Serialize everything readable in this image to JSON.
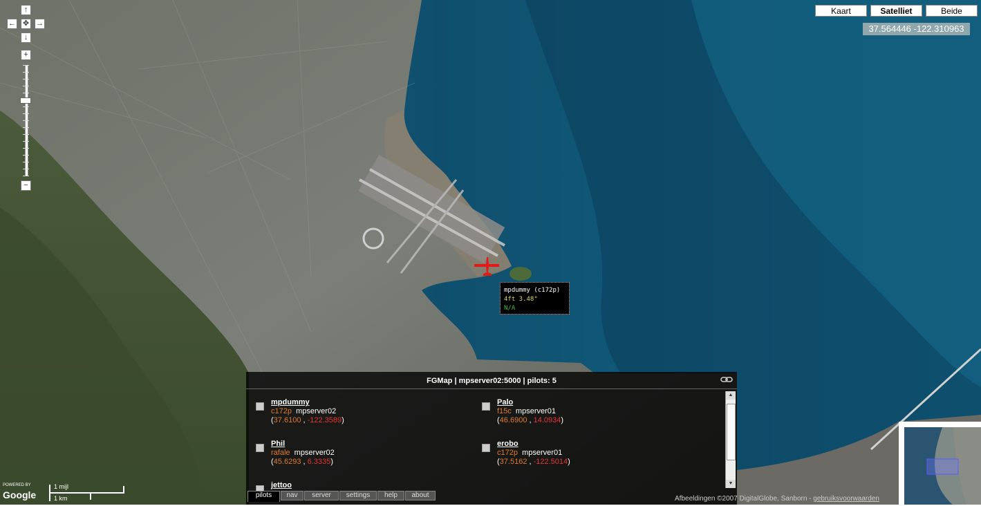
{
  "map_types": [
    {
      "label": "Kaart",
      "active": false
    },
    {
      "label": "Satelliet",
      "active": true
    },
    {
      "label": "Beide",
      "active": false
    }
  ],
  "coordinates": "37.564446 -122.310963",
  "plane_tooltip": {
    "line1": "mpdummy (c172p)",
    "line2": "4ft    3.48°",
    "line3": "N/A"
  },
  "panel": {
    "title": "FGMap | mpserver02:5000 | pilots: 5",
    "pilots": [
      {
        "name": "mpdummy",
        "aircraft": "c172p",
        "server": "mpserver02",
        "lat": "37.6100",
        "lon": "-122.3589"
      },
      {
        "name": "Palo",
        "aircraft": "f15c",
        "server": "mpserver01",
        "lat": "46.6900",
        "lon": "14.0934"
      },
      {
        "name": "Phil",
        "aircraft": "rafale",
        "server": "mpserver02",
        "lat": "45.6293",
        "lon": "6.3335"
      },
      {
        "name": "erobo",
        "aircraft": "c172p",
        "server": "mpserver01",
        "lat": "37.5162",
        "lon": "-122.5014"
      },
      {
        "name": "jettoo",
        "aircraft": "",
        "server": "",
        "lat": "",
        "lon": ""
      }
    ],
    "tabs": [
      {
        "label": "pilots",
        "active": true
      },
      {
        "label": "nav",
        "active": false
      },
      {
        "label": "server",
        "active": false
      },
      {
        "label": "settings",
        "active": false
      },
      {
        "label": "help",
        "active": false
      },
      {
        "label": "about",
        "active": false
      }
    ]
  },
  "footer": {
    "powered_by": "POWERED BY",
    "logo": "Google",
    "scale_miles": "1 mijl",
    "scale_km": "1 km",
    "copyright": "Afbeeldingen ©2007 DigitalGlobe, Sanborn - ",
    "terms": "gebruiksvoorwaarden"
  },
  "icons": [
    "pan-up-icon",
    "pan-left-icon",
    "pan-center-icon",
    "pan-right-icon",
    "pan-down-icon",
    "zoom-in-icon",
    "zoom-out-icon",
    "airplane-icon",
    "link-icon"
  ]
}
